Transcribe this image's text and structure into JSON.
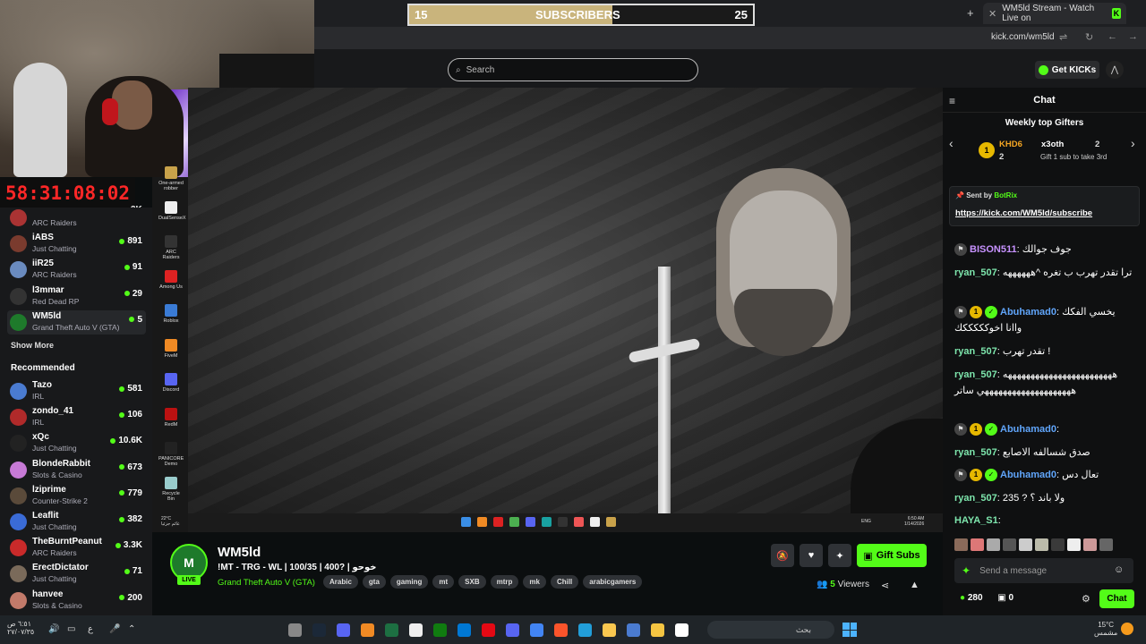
{
  "browser": {
    "tab_title": "WM5ld Stream - Watch Live on",
    "url": "kick.com/wm5ld"
  },
  "overlay": {
    "sub_goal": {
      "current": "15",
      "label": "SUBSCRIBERS",
      "target": "25",
      "progress": 0.59
    },
    "timer": "58:31:08:02",
    "timer_suffix": "3K"
  },
  "header": {
    "search_placeholder": "Search",
    "get_kicks_label": "Get KICKs"
  },
  "sidebar": {
    "followed": [
      {
        "name": "",
        "category": "ARC Raiders",
        "viewers": "",
        "color": "#a33"
      },
      {
        "name": "iABS",
        "category": "Just Chatting",
        "viewers": "891",
        "color": "#7a3b2e"
      },
      {
        "name": "iiR25",
        "category": "ARC Raiders",
        "viewers": "91",
        "color": "#6a8bbf"
      },
      {
        "name": "l3mmar",
        "category": "Red Dead RP",
        "viewers": "29",
        "color": "#333"
      },
      {
        "name": "WM5ld",
        "category": "Grand Theft Auto V (GTA)",
        "viewers": "5",
        "color": "#1e7a2b",
        "active": true
      }
    ],
    "show_more": "Show More",
    "recommended_title": "Recommended",
    "recommended": [
      {
        "name": "Tazo",
        "category": "IRL",
        "viewers": "581",
        "color": "#4a7bd0"
      },
      {
        "name": "zondo_41",
        "category": "IRL",
        "viewers": "106",
        "color": "#b02a2a"
      },
      {
        "name": "xQc",
        "category": "Just Chatting",
        "viewers": "10.6K",
        "color": "#222"
      },
      {
        "name": "BlondeRabbit",
        "category": "Slots & Casino",
        "viewers": "673",
        "color": "#c77ad6"
      },
      {
        "name": "lziprime",
        "category": "Counter-Strike 2",
        "viewers": "779",
        "color": "#5a4a3a"
      },
      {
        "name": "Leaflit",
        "category": "Just Chatting",
        "viewers": "382",
        "color": "#3a6bd6"
      },
      {
        "name": "TheBurntPeanut",
        "category": "ARC Raiders",
        "viewers": "3.3K",
        "color": "#c92a2a"
      },
      {
        "name": "ErectDictator",
        "category": "Just Chatting",
        "viewers": "71",
        "color": "#7a6a5a"
      },
      {
        "name": "hanvee",
        "category": "Slots & Casino",
        "viewers": "200",
        "color": "#c27a6a"
      }
    ]
  },
  "desktop_icons": [
    {
      "label": "One-armed robber",
      "color": "#c9a24a"
    },
    {
      "label": "DualSenseX",
      "color": "#eee"
    },
    {
      "label": "ARC Raiders",
      "color": "#333"
    },
    {
      "label": "Among Us",
      "color": "#d22"
    },
    {
      "label": "Roblox",
      "color": "#3a7bd5"
    },
    {
      "label": "FiveM",
      "color": "#f08a24"
    },
    {
      "label": "Discord",
      "color": "#5865f2"
    },
    {
      "label": "RedM",
      "color": "#b11"
    },
    {
      "label": "PANICORE Demo",
      "color": "#222"
    },
    {
      "label": "Recycle Bin",
      "color": "#9cc"
    }
  ],
  "stream_taskbar": {
    "clock_time": "6:50 AM",
    "clock_date": "1/14/2026",
    "weather_temp": "22°C",
    "weather_text": "غائم جزئيا",
    "lang": "ENG"
  },
  "stream_info": {
    "channel": "WM5ld",
    "title": "!MT - TRG - WL | 100/35 | 400? | خوحو",
    "game": "Grand Theft Auto V (GTA)",
    "live_label": "LIVE",
    "tags": [
      "Arabic",
      "gta",
      "gaming",
      "mt",
      "SXB",
      "mtrp",
      "mk",
      "Chill",
      "arabicgamers"
    ],
    "viewers_count": "5",
    "viewers_label": "Viewers",
    "gift_subs_label": "Gift Subs"
  },
  "chat": {
    "title": "Chat",
    "gifters_title": "Weekly top Gifters",
    "gifters": [
      {
        "name": "KHD6",
        "count": "2"
      },
      {
        "name": "x3oth",
        "count": "2"
      }
    ],
    "gift_hint": "Gift 1 sub to take 3rd",
    "pinned": {
      "sent_by": "Sent by",
      "author": "BotRix",
      "link": "https://kick.com/WM5ld/subscribe"
    },
    "messages": [
      {
        "user": "BISON511",
        "text": "جوف جوالك",
        "color": "#c792ff",
        "badges": "mod"
      },
      {
        "user": "ryan_507",
        "text": "ترا تقدر تهرب ب تغره ^ههههههه",
        "color": "#7ee6ad",
        "badges": ""
      },
      {
        "user": "Abuhamad0",
        "text": "يخسي الفكك واانا اخوكككككك",
        "color": "#60a5fa",
        "badges": "mod-sub-verified"
      },
      {
        "user": "ryan_507",
        "text": "تقدر تهرب ! ",
        "color": "#7ee6ad",
        "badges": ""
      },
      {
        "user": "ryan_507",
        "text": "ههههههههههههههههههههههههه ههههههههههههههههههههي ساتر",
        "color": "#7ee6ad",
        "badges": ""
      },
      {
        "user": "Abuhamad0",
        "text": "",
        "color": "#60a5fa",
        "badges": "mod-sub-verified"
      },
      {
        "user": "ryan_507",
        "text": "صدق شسالفه الاصابع",
        "color": "#7ee6ad",
        "badges": ""
      },
      {
        "user": "Abuhamad0",
        "text": "تعال دس",
        "color": "#60a5fa",
        "badges": "mod-sub-verified"
      },
      {
        "user": "ryan_507",
        "text": "235 ? ولا باند ؟",
        "color": "#7ee6ad",
        "badges": ""
      },
      {
        "user": "HAYA_S1",
        "text": "",
        "color": "#7ee6ad",
        "badges": ""
      }
    ],
    "input_placeholder": "Send a message",
    "kicks_balance": "280",
    "second_balance": "0",
    "send_label": "Chat"
  },
  "taskbar": {
    "search_text": "بحث",
    "weather_temp": "15°C",
    "weather_text": "مشمس",
    "time": "٦:٥١ ص",
    "date": "٢٧/٠٧/٣٥",
    "lang": "ع"
  }
}
